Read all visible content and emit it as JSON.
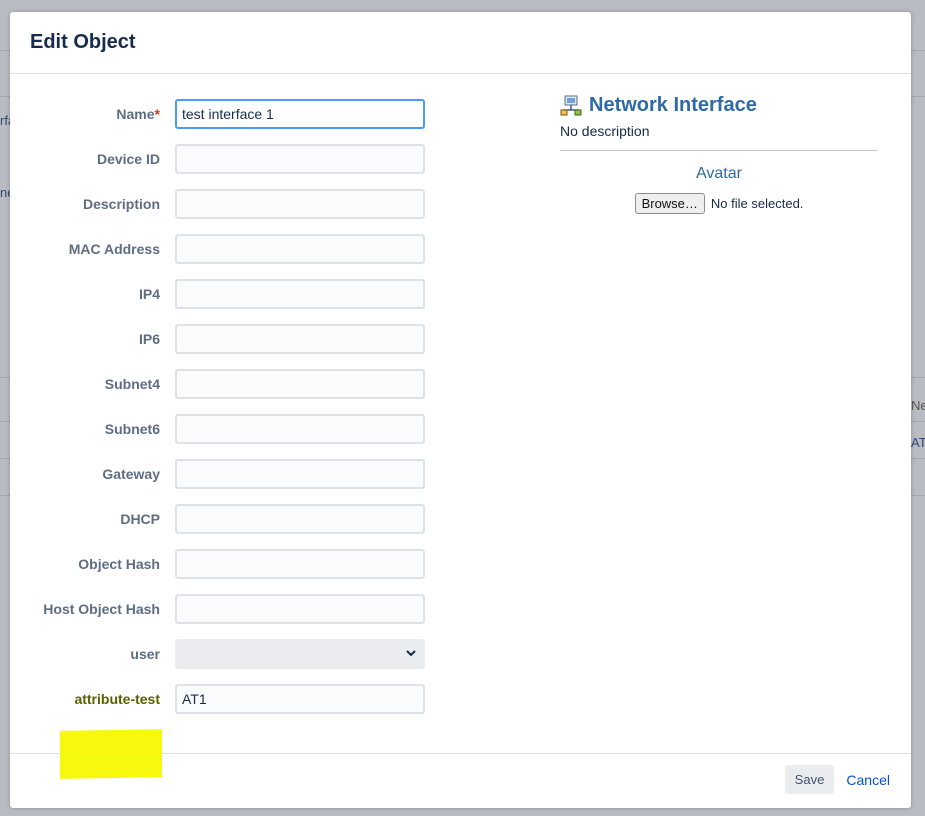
{
  "background": {
    "fragments": [
      "rfa",
      "ne",
      "Ne",
      "AT"
    ]
  },
  "dialog": {
    "title": "Edit Object"
  },
  "form": {
    "required_marker": "*",
    "fields": [
      {
        "label": "Name",
        "value": "test interface 1",
        "required": true
      },
      {
        "label": "Device ID",
        "value": ""
      },
      {
        "label": "Description",
        "value": ""
      },
      {
        "label": "MAC Address",
        "value": ""
      },
      {
        "label": "IP4",
        "value": ""
      },
      {
        "label": "IP6",
        "value": ""
      },
      {
        "label": "Subnet4",
        "value": ""
      },
      {
        "label": "Subnet6",
        "value": ""
      },
      {
        "label": "Gateway",
        "value": ""
      },
      {
        "label": "DHCP",
        "value": ""
      },
      {
        "label": "Object Hash",
        "value": ""
      },
      {
        "label": "Host Object Hash",
        "value": ""
      },
      {
        "label": "user",
        "value": "",
        "type": "select"
      },
      {
        "label": "attribute-test",
        "value": "AT1",
        "highlighted": true
      }
    ]
  },
  "object_type": {
    "icon": "network-interface-icon",
    "name": "Network Interface",
    "description": "No description"
  },
  "avatar": {
    "title": "Avatar",
    "browse_label": "Browse…",
    "file_status": "No file selected."
  },
  "footer": {
    "save_label": "Save",
    "cancel_label": "Cancel"
  },
  "colors": {
    "highlight": "#f8f80e",
    "link": "#0052cc",
    "accent": "#2e6aa6"
  }
}
